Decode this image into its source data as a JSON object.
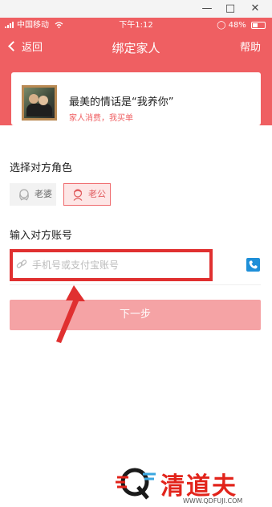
{
  "status": {
    "carrier": "中国移动",
    "time": "下午1:12",
    "battery": "48%"
  },
  "nav": {
    "back_label": "返回",
    "title": "绑定家人",
    "help_label": "帮助"
  },
  "card": {
    "title": "最美的情话是“我养你”",
    "subtitle": "家人消费，我买单"
  },
  "role_section": {
    "label": "选择对方角色",
    "options": [
      {
        "label": "老婆",
        "selected": false
      },
      {
        "label": "老公",
        "selected": true
      }
    ]
  },
  "account_section": {
    "label": "输入对方账号",
    "input_placeholder": "手机号或支付宝账号",
    "input_value": ""
  },
  "next_button": {
    "label": "下一步"
  },
  "watermark": {
    "brand": "清道夫",
    "url": "WWW.QDFUJI.COM"
  },
  "colors": {
    "brand_red": "#ef5f62",
    "annotation_red": "#e03030",
    "button_disabled": "#f5a3a5",
    "contact_icon_blue": "#1e8fd8"
  }
}
